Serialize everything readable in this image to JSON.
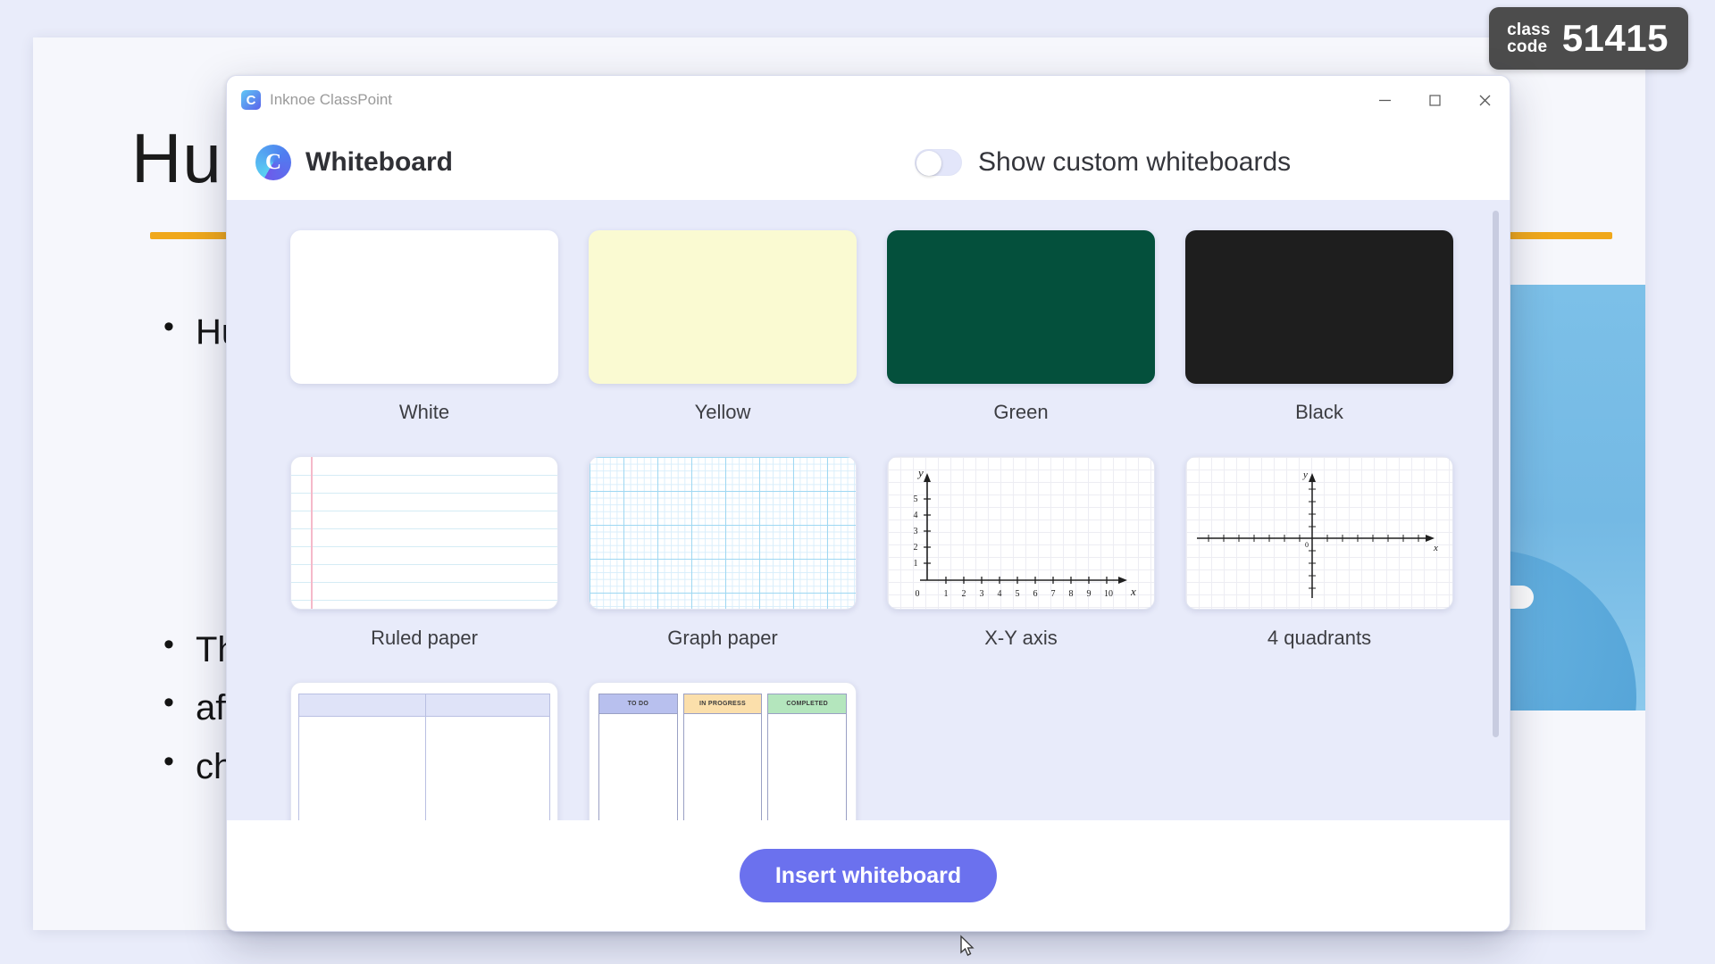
{
  "slide": {
    "title": "Hu",
    "bullets": [
      "Hum",
      "The",
      "affe",
      "char"
    ],
    "sub_bullet_count": 5,
    "artwork_name": "earth-environment-illustration",
    "accent_rule_color": "#f0a81b"
  },
  "class_code_badge": {
    "label_line1": "class",
    "label_line2": "code",
    "code": "51415",
    "background": "#4c4c4c"
  },
  "window": {
    "app_title": "Inknoe ClassPoint",
    "app_icon_glyph": "C",
    "controls": {
      "minimize": "—",
      "maximize": "□",
      "close": "✕"
    }
  },
  "panel": {
    "logo_glyph": "C",
    "title": "Whiteboard",
    "toggle": {
      "label": "Show custom whiteboards",
      "state": "off",
      "track_color": "#e3e6fa"
    }
  },
  "templates": [
    {
      "name": "White",
      "caption": "White",
      "kind": "solid",
      "color": "#ffffff"
    },
    {
      "name": "Yellow",
      "caption": "Yellow",
      "kind": "solid",
      "color": "#fafad2"
    },
    {
      "name": "Green",
      "caption": "Green",
      "kind": "solid",
      "color": "#04503c"
    },
    {
      "name": "Black",
      "caption": "Black",
      "kind": "solid",
      "color": "#1e1e1e"
    },
    {
      "name": "Ruled paper",
      "caption": "Ruled paper",
      "kind": "ruled",
      "line_color": "#d5ecf5",
      "margin_color": "#f5b9c9"
    },
    {
      "name": "Graph paper",
      "caption": "Graph paper",
      "kind": "graph",
      "grid_color": "#9fd8f2"
    },
    {
      "name": "X-Y axis",
      "caption": "X-Y axis",
      "kind": "xyaxis"
    },
    {
      "name": "4 quadrants",
      "caption": "4 quadrants",
      "kind": "quadrants"
    },
    {
      "name": "Table",
      "caption": "",
      "kind": "table"
    },
    {
      "name": "Kanban",
      "caption": "",
      "kind": "kanban"
    }
  ],
  "xy_axis": {
    "x_label": "x",
    "y_label": "y",
    "x_ticks": [
      "0",
      "1",
      "2",
      "3",
      "4",
      "5",
      "6",
      "7",
      "8",
      "9",
      "10"
    ],
    "y_ticks": [
      "1",
      "2",
      "3",
      "4",
      "5"
    ]
  },
  "quadrants": {
    "x_label": "x",
    "y_label": "y",
    "origin_label": "0"
  },
  "kanban_columns": [
    {
      "title": "TO DO",
      "color": "#b8c0ee"
    },
    {
      "title": "IN PROGRESS",
      "color": "#fbdfab"
    },
    {
      "title": "COMPLETED",
      "color": "#b4e6bd"
    }
  ],
  "footer": {
    "insert_button": "Insert whiteboard",
    "button_color": "#6b71ee"
  }
}
